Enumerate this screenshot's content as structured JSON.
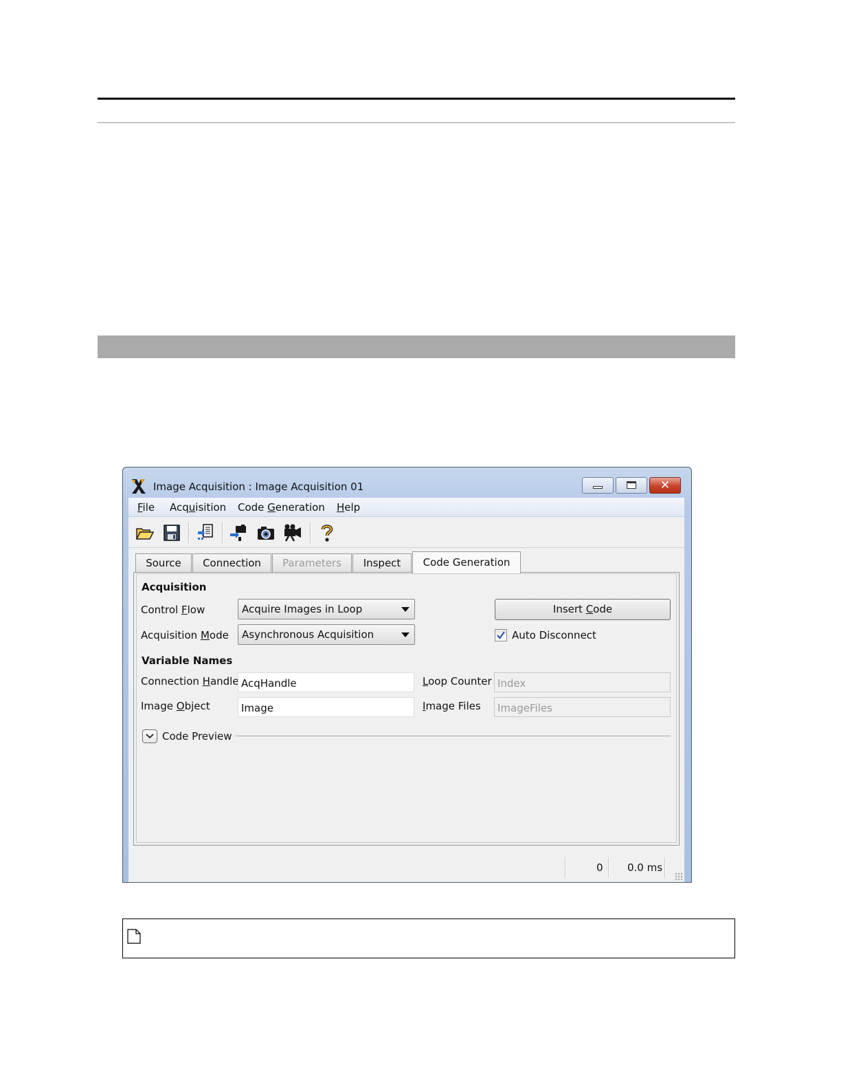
{
  "window": {
    "title": "Image Acquisition : Image Acquisition 01",
    "close_glyph": "✕"
  },
  "menu": {
    "file": {
      "pre": "",
      "key": "F",
      "post": "ile"
    },
    "acquisition": {
      "pre": "Acq",
      "key": "u",
      "post": "isition"
    },
    "code_generation": {
      "pre": "Code ",
      "key": "G",
      "post": "eneration"
    },
    "help": {
      "pre": "",
      "key": "H",
      "post": "elp"
    }
  },
  "toolbar": {
    "icons": [
      "open-folder-icon",
      "save-icon",
      "insert-code-icon",
      "connect-icon",
      "snap-camera-icon",
      "live-camera-icon",
      "help-icon"
    ]
  },
  "tabs": [
    {
      "label": "Source",
      "state": "normal"
    },
    {
      "label": "Connection",
      "state": "normal"
    },
    {
      "label": "Parameters",
      "state": "disabled"
    },
    {
      "label": "Inspect",
      "state": "normal"
    },
    {
      "label": "Code Generation",
      "state": "active"
    }
  ],
  "acquisition": {
    "heading": "Acquisition",
    "control_flow": {
      "label_pre": "Control ",
      "label_key": "F",
      "label_post": "low",
      "value": "Acquire Images in Loop"
    },
    "acquisition_mode": {
      "label_pre": "Acquisition ",
      "label_key": "M",
      "label_post": "ode",
      "value": "Asynchronous Acquisition"
    },
    "insert_code": {
      "pre": "Insert ",
      "key": "C",
      "post": "ode"
    },
    "auto_disconnect": {
      "label": "Auto Disconnect",
      "checked": true
    }
  },
  "variable_names": {
    "heading": "Variable Names",
    "connection_handle": {
      "label_pre": "Connection ",
      "label_key": "H",
      "label_post": "andle",
      "value": "AcqHandle"
    },
    "image_object": {
      "label_pre": "Image ",
      "label_key": "O",
      "label_post": "bject",
      "value": "Image"
    },
    "loop_counter": {
      "label_pre": "",
      "label_key": "L",
      "label_post": "oop Counter",
      "placeholder": "Index"
    },
    "image_files": {
      "label_pre": "",
      "label_key": "I",
      "label_post": "mage Files",
      "placeholder": "ImageFiles"
    }
  },
  "code_preview": {
    "label": "Code Preview",
    "expanded": false
  },
  "status": {
    "count": "0",
    "time": "0.0 ms"
  },
  "colors": {
    "title_gradient": "#b4c9e6",
    "close_button": "#c7432c",
    "panel_bg": "#f0f0f0"
  }
}
